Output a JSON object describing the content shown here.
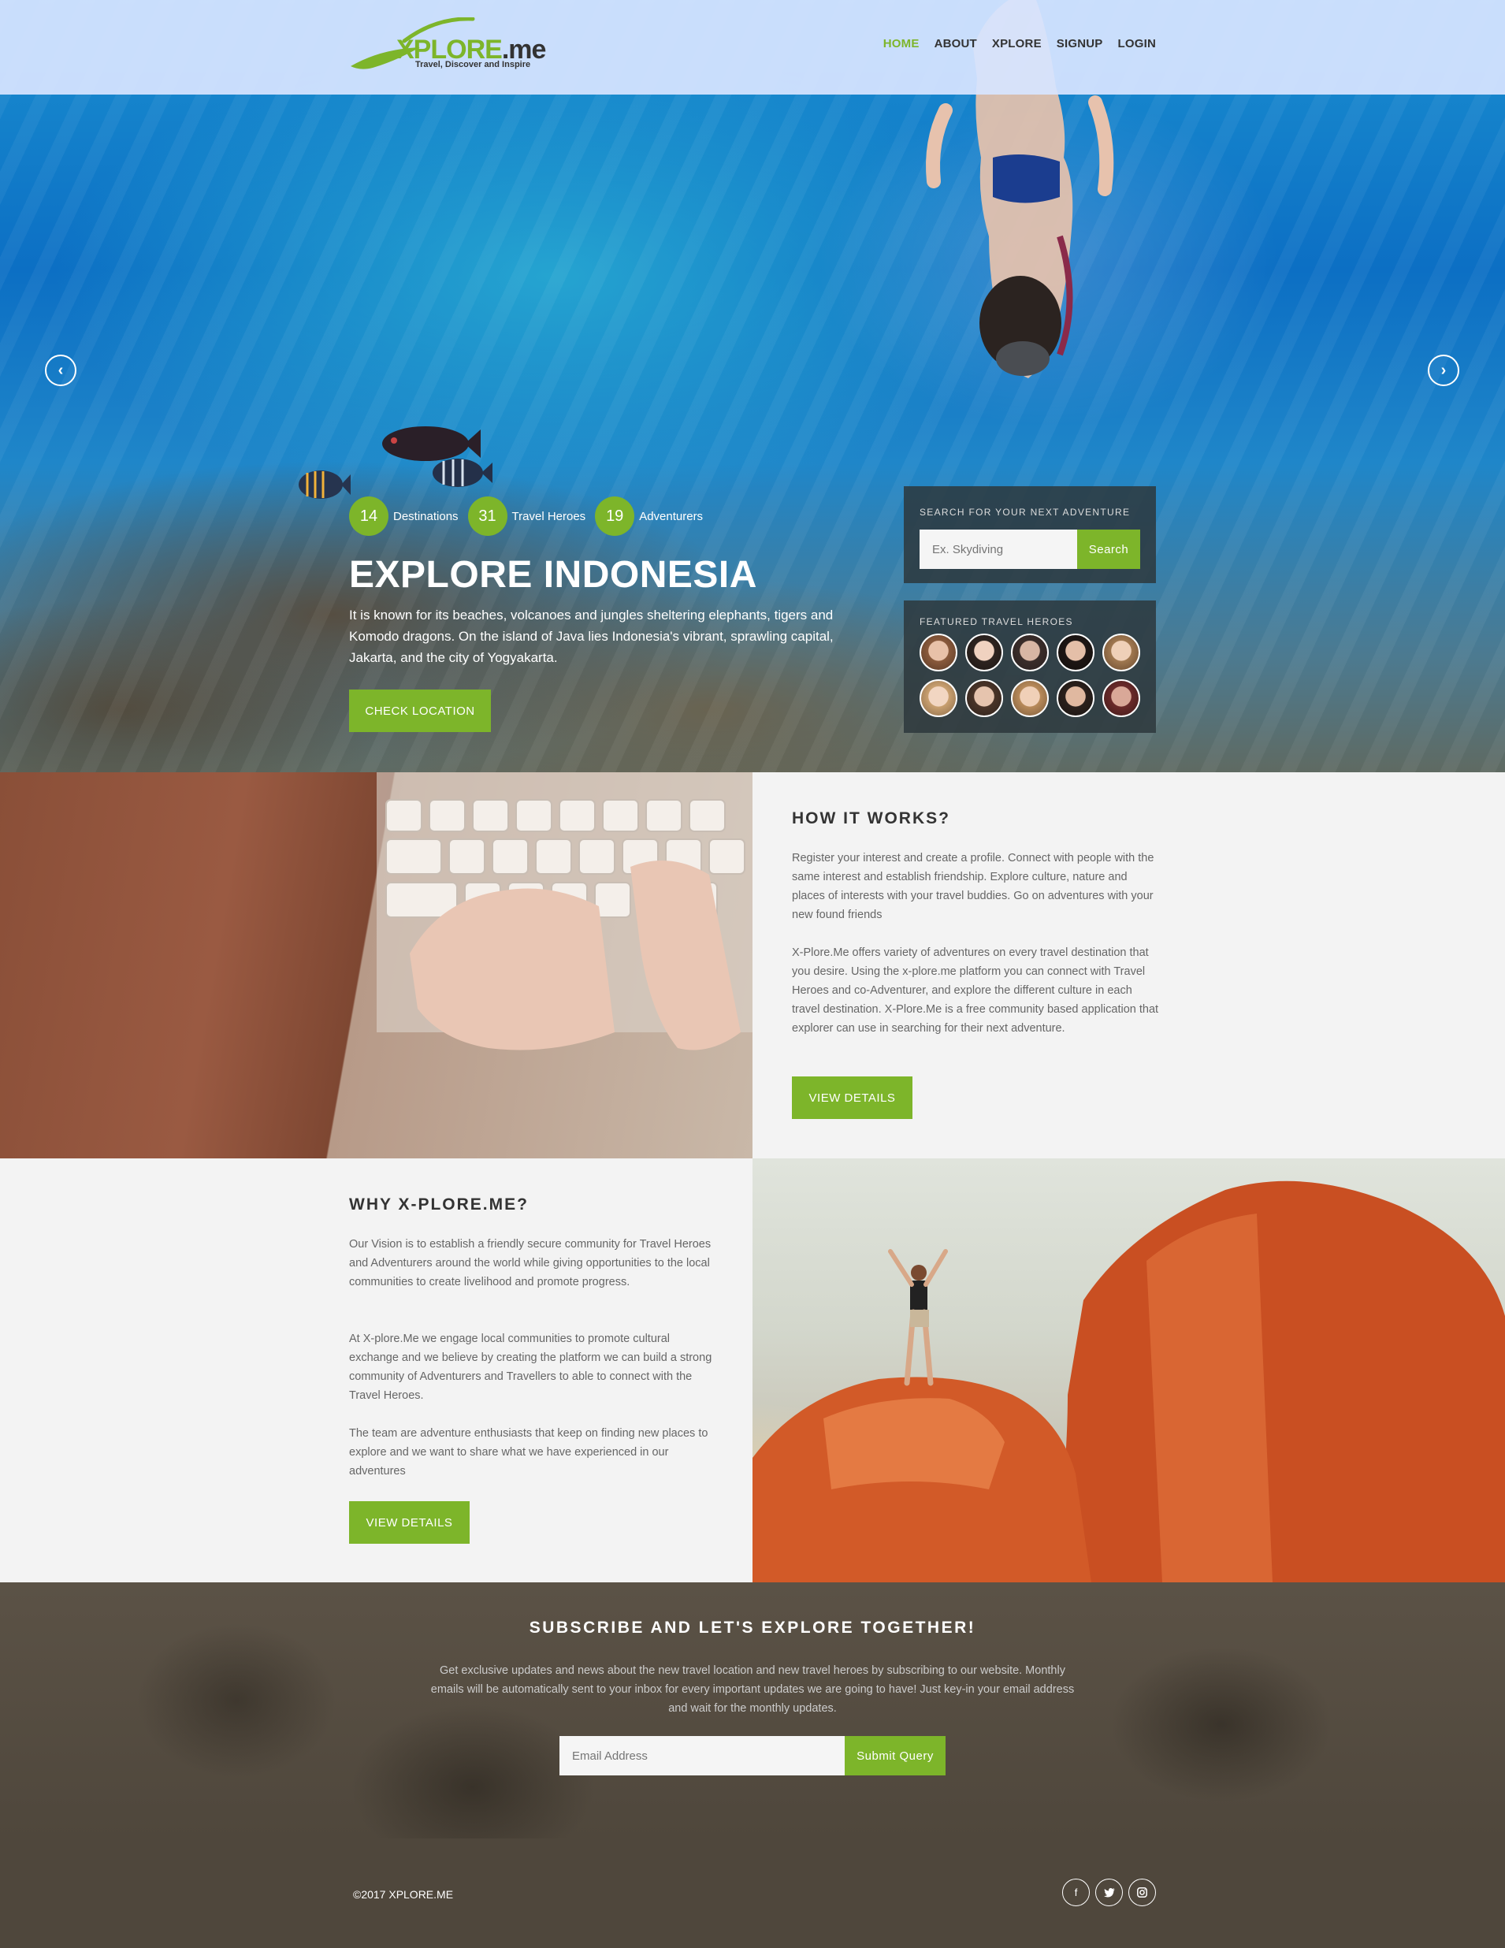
{
  "brand": {
    "logo_main": "XPLORE",
    "logo_suffix": ".me",
    "tagline": "Travel, Discover and Inspire"
  },
  "nav": {
    "items": [
      "HOME",
      "ABOUT",
      "XPLORE",
      "SIGNUP",
      "LOGIN"
    ],
    "active": "HOME",
    "active_color": "#7db52a"
  },
  "hero": {
    "stats": [
      {
        "number": "14",
        "label": "Destinations"
      },
      {
        "number": "31",
        "label": "Travel Heroes"
      },
      {
        "number": "19",
        "label": "Adventurers"
      }
    ],
    "title": "EXPLORE INDONESIA",
    "description": "It is known for its beaches, volcanoes and jungles sheltering elephants, tigers and Komodo dragons. On the island of Java lies Indonesia's vibrant, sprawling capital, Jakarta, and the city of Yogyakarta.",
    "button_label": "CHECK LOCATION",
    "prev_icon": "chevron-left-icon",
    "next_icon": "chevron-right-icon"
  },
  "search_panel": {
    "heading": "SEARCH FOR YOUR NEXT ADVENTURE",
    "placeholder": "Ex. Skydiving",
    "button_label": "Search"
  },
  "heroes_panel": {
    "heading": "FEATURED TRAVEL HEROES",
    "avatar_count": 10
  },
  "how_it_works": {
    "title": "HOW IT WORKS?",
    "paragraph_1": "Register your interest and create a profile. Connect with people with the same interest and establish friendship. Explore culture, nature and places of interests with your travel buddies. Go on adventures with your new found friends",
    "paragraph_2": "X-Plore.Me offers variety of adventures on every travel destination that you desire. Using the x-plore.me platform you can connect with Travel Heroes and co-Adventurer, and explore the different culture in each travel destination. X-Plore.Me is a free community based application that explorer can use in searching for their next adventure.",
    "button_label": "VIEW DETAILS"
  },
  "why": {
    "title": "WHY X-PLORE.ME?",
    "paragraph_1": "Our Vision is to establish a friendly secure community for Travel Heroes and Adventurers around the world while giving opportunities to the local communities to create livelihood and promote progress.",
    "paragraph_2": "At X-plore.Me we engage local communities to promote cultural exchange and we believe by creating the platform we can build a strong community of Adventurers and Travellers to able to connect with the Travel Heroes.",
    "paragraph_3": "The team are adventure enthusiasts that keep on finding new places to explore and we want to share what we have experienced in our adventures",
    "button_label": "VIEW DETAILS"
  },
  "subscribe": {
    "title": "SUBSCRIBE AND LET'S EXPLORE TOGETHER!",
    "description": "Get exclusive updates and news about the new travel location and new travel heroes by subscribing to our website. Monthly emails will be automatically sent to your inbox for every important updates we are going to have! Just key-in your email address and wait for the monthly updates.",
    "placeholder": "Email Address",
    "button_label": "Submit Query"
  },
  "footer": {
    "copyright": "©2017 XPLORE.ME",
    "socials": [
      "facebook-icon",
      "twitter-icon",
      "instagram-icon"
    ]
  },
  "colors": {
    "accent": "#7db52a",
    "footer_bg": "#4f473c",
    "panel_bg": "#2d373c"
  }
}
